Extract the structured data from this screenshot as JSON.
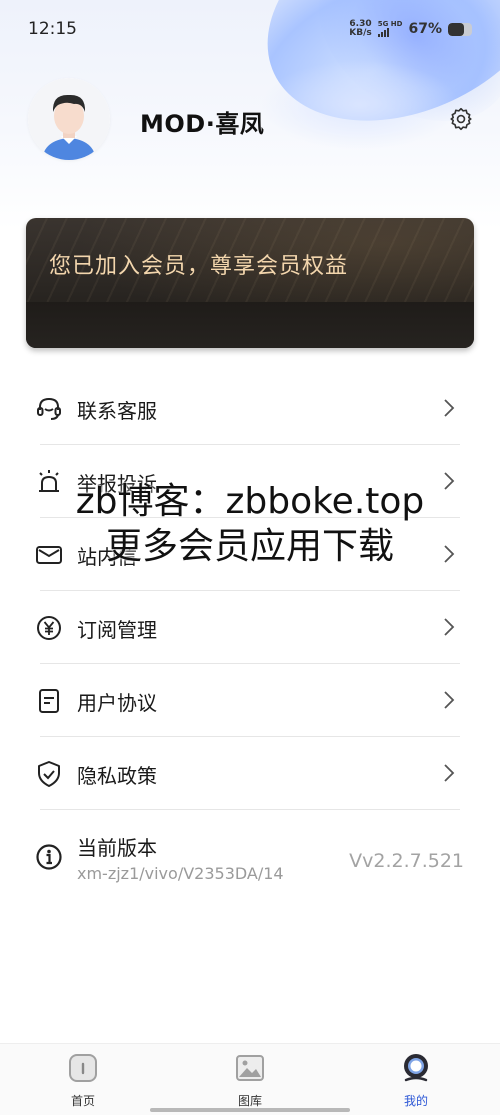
{
  "status_bar": {
    "time": "12:15",
    "net_speed_value": "6.30",
    "net_speed_unit": "KB/s",
    "signal_label": "5G HD",
    "battery_percent": "67%",
    "battery_level": 0.67
  },
  "profile": {
    "username": "MOD·喜凤",
    "avatar_icon": "user-avatar-icon",
    "settings_icon": "gear-icon"
  },
  "vip_card": {
    "text": "您已加入会员，尊享会员权益"
  },
  "menu": {
    "items": [
      {
        "label": "联系客服",
        "icon": "headset-icon"
      },
      {
        "label": "举报投诉",
        "icon": "alarm-icon"
      },
      {
        "label": "站内信",
        "icon": "mail-icon"
      },
      {
        "label": "订阅管理",
        "icon": "yen-icon"
      },
      {
        "label": "用户协议",
        "icon": "document-icon"
      },
      {
        "label": "隐私政策",
        "icon": "shield-icon"
      }
    ],
    "version": {
      "title": "当前版本",
      "device": "xm-zjz1/vivo/V2353DA/14",
      "value": "Vv2.2.7.521",
      "icon": "info-icon"
    }
  },
  "watermark": {
    "line1": "zb博客：zbboke.top",
    "line2": "更多会员应用下载"
  },
  "bottom_nav": {
    "items": [
      {
        "label": "首页",
        "icon": "home-icon",
        "active": false
      },
      {
        "label": "图库",
        "icon": "gallery-icon",
        "active": false
      },
      {
        "label": "我的",
        "icon": "profile-icon",
        "active": true
      }
    ]
  },
  "colors": {
    "accent": "#2c57d6",
    "vip_text": "#f3d6ad",
    "vip_bg": "#2a2622"
  }
}
